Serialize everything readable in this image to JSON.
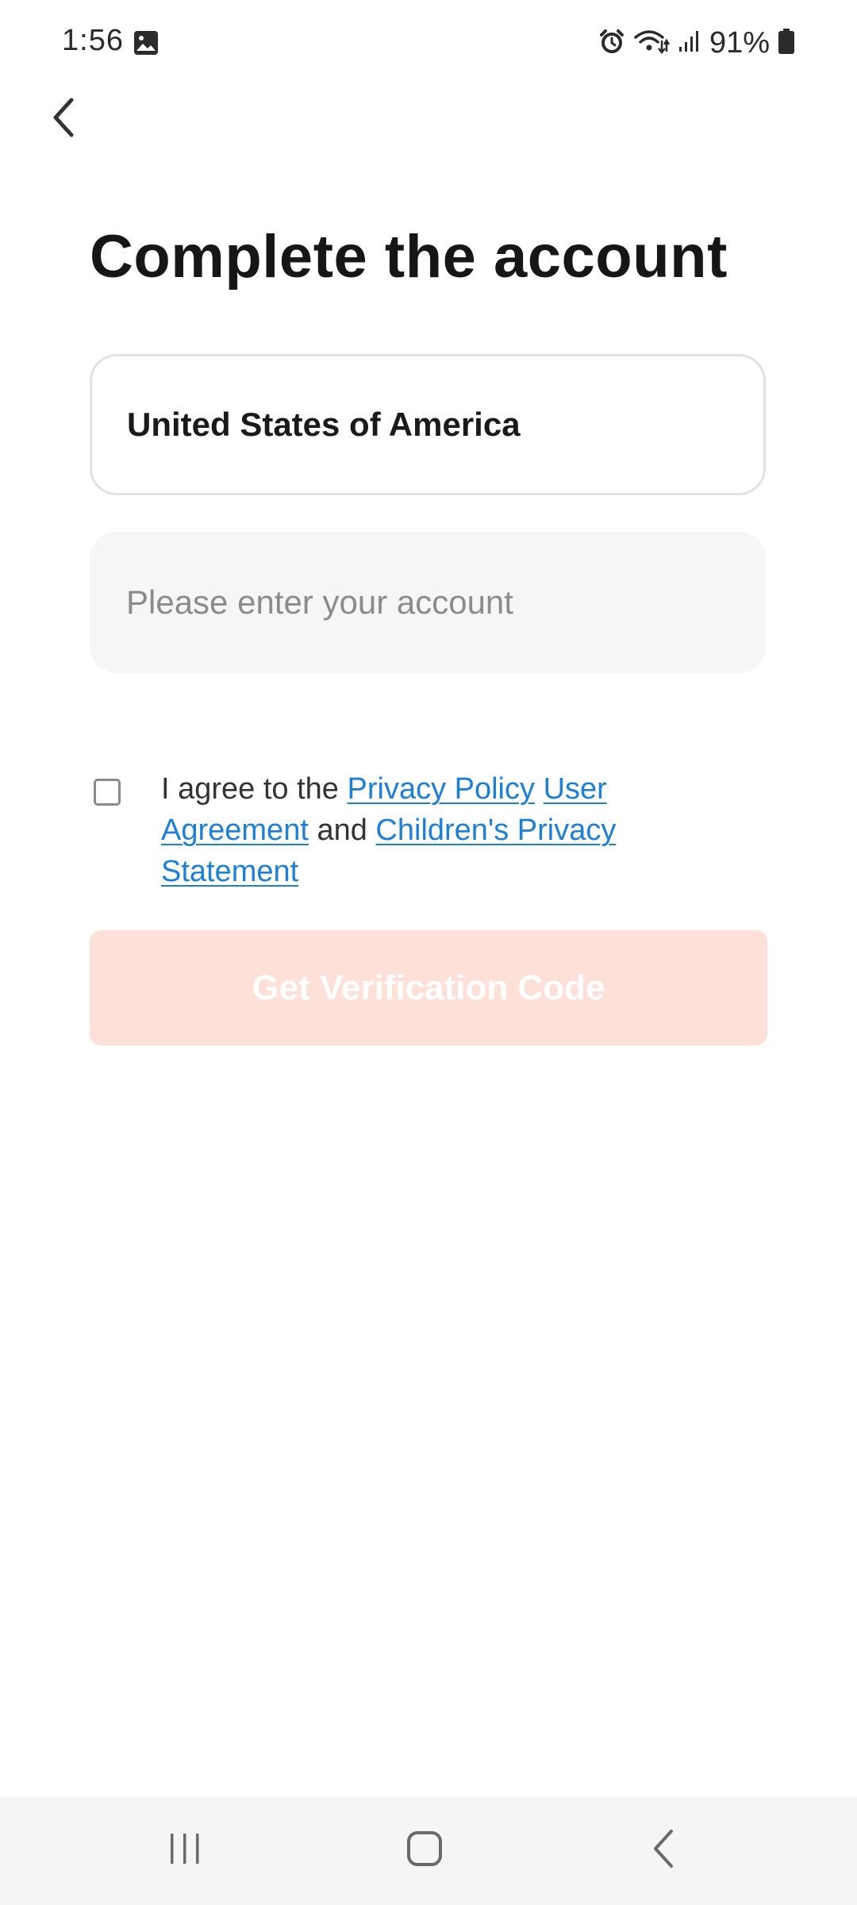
{
  "status_bar": {
    "time": "1:56",
    "battery": "91%",
    "icons": [
      "gallery-icon",
      "alarm-icon",
      "wifi-icon",
      "signal-icon",
      "battery-icon"
    ]
  },
  "header": {
    "back_icon": "chevron-left-icon"
  },
  "main": {
    "title": "Complete the account",
    "country_value": "United States of America",
    "account_placeholder": "Please enter your account",
    "account_value": "",
    "agreement": {
      "checked": false,
      "prefix": "I agree to the",
      "privacy_policy": "Privacy Policy",
      "user_agreement": "User Agreement",
      "conjunction": "and",
      "children_privacy": "Children's Privacy Statement"
    },
    "verify_button_label": "Get Verification Code"
  },
  "colors": {
    "accent_disabled": "#fde0d8",
    "link": "#1e7fd6"
  },
  "nav_bar": {
    "icons": [
      "recents-icon",
      "home-icon",
      "back-icon"
    ]
  }
}
